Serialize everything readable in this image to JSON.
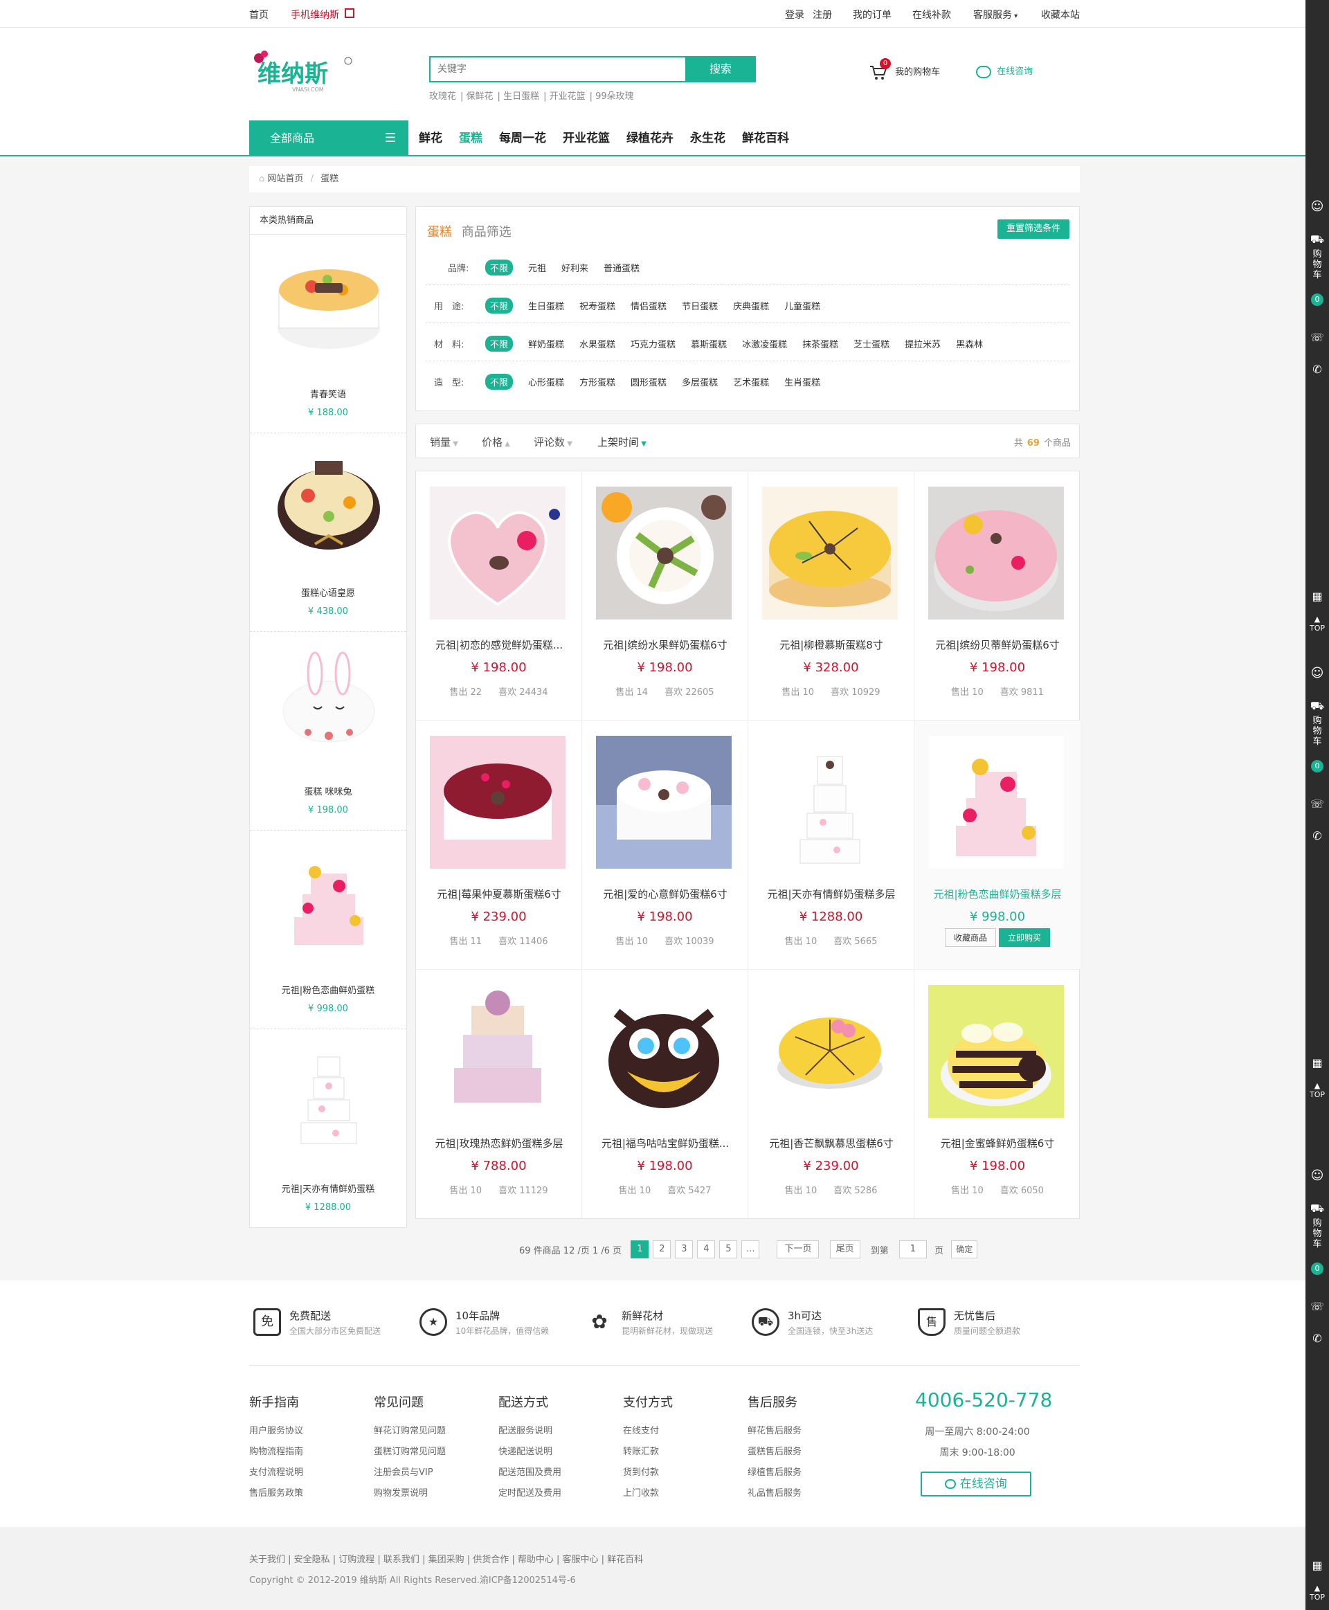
{
  "topbar": {
    "home": "首页",
    "mobile": "手机维纳斯",
    "login": "登录",
    "register": "注册",
    "orders": "我的订单",
    "payment": "在线补款",
    "service": "客服服务",
    "favorite": "收藏本站"
  },
  "header": {
    "logo_text": "维纳斯",
    "logo_sub": "VNASI.COM",
    "search_placeholder": "关键字",
    "search_btn": "搜索",
    "hot_words": [
      "玫瑰花",
      "保鲜花",
      "生日蛋糕",
      "开业花篮",
      "99朵玫瑰"
    ],
    "cart_label": "我的购物车",
    "cart_count": "0",
    "consult_label": "在线咨询",
    "all_categories": "全部商品",
    "nav": [
      "鲜花",
      "蛋糕",
      "每周一花",
      "开业花篮",
      "绿植花卉",
      "永生花",
      "鲜花百科"
    ],
    "nav_active": 1
  },
  "breadcrumb": {
    "home": "网站首页",
    "sep": "/",
    "current": "蛋糕"
  },
  "sidebar": {
    "title": "本类热销商品",
    "items": [
      {
        "name": "青春笑语",
        "price": "¥ 188.00"
      },
      {
        "name": "蛋糕心语皇愿",
        "price": "¥ 438.00"
      },
      {
        "name": "蛋糕 咪咪兔",
        "price": "¥ 198.00"
      },
      {
        "name": "元祖|粉色恋曲鲜奶蛋糕",
        "price": "¥ 998.00"
      },
      {
        "name": "元祖|天亦有情鲜奶蛋糕",
        "price": "¥ 1288.00"
      }
    ]
  },
  "filter": {
    "category": "蛋糕",
    "title": "商品筛选",
    "reset": "重置筛选条件",
    "rows": [
      {
        "label": "品牌:",
        "options": [
          "不限",
          "元祖",
          "好利来",
          "普通蛋糕"
        ]
      },
      {
        "label": "用　途:",
        "options": [
          "不限",
          "生日蛋糕",
          "祝寿蛋糕",
          "情侣蛋糕",
          "节日蛋糕",
          "庆典蛋糕",
          "儿童蛋糕"
        ]
      },
      {
        "label": "材　料:",
        "options": [
          "不限",
          "鲜奶蛋糕",
          "水果蛋糕",
          "巧克力蛋糕",
          "慕斯蛋糕",
          "冰激凌蛋糕",
          "抹茶蛋糕",
          "芝士蛋糕",
          "提拉米苏",
          "黑森林"
        ]
      },
      {
        "label": "造　型:",
        "options": [
          "不限",
          "心形蛋糕",
          "方形蛋糕",
          "圆形蛋糕",
          "多层蛋糕",
          "艺术蛋糕",
          "生肖蛋糕"
        ]
      }
    ]
  },
  "sortbar": {
    "items": [
      "销量",
      "价格",
      "评论数",
      "上架时间"
    ],
    "active": 3,
    "total_prefix": "共",
    "total": "69",
    "total_suffix": "个商品"
  },
  "products": [
    {
      "name": "元祖|初恋的感觉鲜奶蛋糕...",
      "price": "¥ 198.00",
      "sold": "售出 22",
      "likes": "喜欢 24434"
    },
    {
      "name": "元祖|缤纷水果鲜奶蛋糕6寸",
      "price": "¥ 198.00",
      "sold": "售出 14",
      "likes": "喜欢 22605"
    },
    {
      "name": "元祖|柳橙慕斯蛋糕8寸",
      "price": "¥ 328.00",
      "sold": "售出 10",
      "likes": "喜欢 10929"
    },
    {
      "name": "元祖|缤纷贝蒂鲜奶蛋糕6寸",
      "price": "¥ 198.00",
      "sold": "售出 10",
      "likes": "喜欢 9811"
    },
    {
      "name": "元祖|莓果仲夏慕斯蛋糕6寸",
      "price": "¥ 239.00",
      "sold": "售出 11",
      "likes": "喜欢 11406"
    },
    {
      "name": "元祖|爱的心意鲜奶蛋糕6寸",
      "price": "¥ 198.00",
      "sold": "售出 10",
      "likes": "喜欢 10039"
    },
    {
      "name": "元祖|天亦有情鲜奶蛋糕多层",
      "price": "¥ 1288.00",
      "sold": "售出 10",
      "likes": "喜欢 5665"
    },
    {
      "name": "元祖|粉色恋曲鲜奶蛋糕多层",
      "price": "¥ 998.00",
      "fav": "收藏商品",
      "buy": "立即购买"
    },
    {
      "name": "元祖|玫瑰热恋鲜奶蛋糕多层",
      "price": "¥ 788.00",
      "sold": "售出 10",
      "likes": "喜欢 11129"
    },
    {
      "name": "元祖|福鸟咕咕宝鲜奶蛋糕...",
      "price": "¥ 198.00",
      "sold": "售出 10",
      "likes": "喜欢 5427"
    },
    {
      "name": "元祖|香芒飘飘慕思蛋糕6寸",
      "price": "¥ 239.00",
      "sold": "售出 10",
      "likes": "喜欢 5286"
    },
    {
      "name": "元祖|金蜜蜂鲜奶蛋糕6寸",
      "price": "¥ 198.00",
      "sold": "售出 10",
      "likes": "喜欢 6050"
    }
  ],
  "pager": {
    "summary": "69 件商品 12 /页 1 /6 页",
    "pages": [
      "1",
      "2",
      "3",
      "4",
      "5",
      "..."
    ],
    "next": "下一页",
    "last": "尾页",
    "goto": "到第",
    "goto_value": "1",
    "page_unit": "页",
    "confirm": "确定"
  },
  "features": [
    {
      "title": "免费配送",
      "desc": "全国大部分市区免费配送",
      "glyph": "免"
    },
    {
      "title": "10年品牌",
      "desc": "10年鲜花品牌，值得信赖",
      "glyph": "★"
    },
    {
      "title": "新鲜花材",
      "desc": "昆明新鲜花材，现做现送",
      "glyph": "✿"
    },
    {
      "title": "3h可达",
      "desc": "全国连锁，快至3h送达",
      "glyph": "⛟"
    },
    {
      "title": "无忧售后",
      "desc": "质量问题全额退款",
      "glyph": "售"
    }
  ],
  "footer_cols": [
    {
      "title": "新手指南",
      "items": [
        "用户服务协议",
        "购物流程指南",
        "支付流程说明",
        "售后服务政策"
      ]
    },
    {
      "title": "常见问题",
      "items": [
        "鲜花订购常见问题",
        "蛋糕订购常见问题",
        "注册会员与VIP",
        "购物发票说明"
      ]
    },
    {
      "title": "配送方式",
      "items": [
        "配送服务说明",
        "快递配送说明",
        "配送范围及费用",
        "定时配送及费用"
      ]
    },
    {
      "title": "支付方式",
      "items": [
        "在线支付",
        "转账汇款",
        "货到付款",
        "上门收款"
      ]
    },
    {
      "title": "售后服务",
      "items": [
        "鲜花售后服务",
        "蛋糕售后服务",
        "绿植售后服务",
        "礼品售后服务"
      ]
    }
  ],
  "contact": {
    "hotline": "4006-520-778",
    "hours1": "周一至周六 8:00-24:00",
    "hours2": "周末 9:00-18:00",
    "consult": "在线咨询"
  },
  "bottom": {
    "links": "关于我们 | 安全隐私 | 订购流程 | 联系我们 | 集团采购 | 供货合作 | 帮助中心 | 客服中心 | 鲜花百科",
    "copyright": "Copyright © 2012-2019 维纳斯 All Rights Reserved.渝ICP备12002514号-6"
  },
  "rightbar": {
    "cart": "购物车",
    "count": "0",
    "top": "TOP"
  },
  "colors": {
    "accent": "#1ab394",
    "price": "#d6122a",
    "orange": "#e6a23c"
  }
}
